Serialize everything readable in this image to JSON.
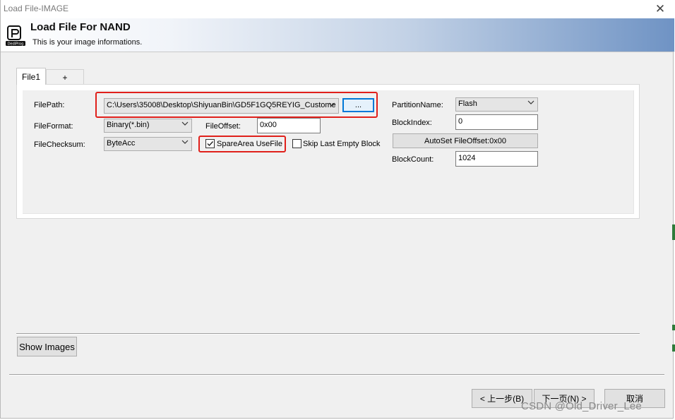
{
  "window": {
    "title": "Load File-IMAGE",
    "close_symbol": "✕"
  },
  "banner": {
    "logo_icon": "dediprog-logo-icon",
    "logo_text": "DediProg",
    "title": "Load File For NAND",
    "subtitle": "This is your image informations."
  },
  "tabs": [
    {
      "label": "File1",
      "active": true
    },
    {
      "label": "+",
      "active": false
    }
  ],
  "form": {
    "filepath_label": "FilePath:",
    "filepath_value": "C:\\Users\\35008\\Desktop\\ShiyuanBin\\GD5F1GQ5REYIG_Custome",
    "browse_label": "...",
    "fileformat_label": "FileFormat:",
    "fileformat_value": "Binary(*.bin)",
    "fileoffset_label": "FileOffset:",
    "fileoffset_value": "0x00",
    "filechecksum_label": "FileChecksum:",
    "filechecksum_value": "ByteAcc",
    "sparearea_label": "SpareArea UseFile",
    "sparearea_checked": true,
    "skip_label": "Skip Last Empty Block",
    "skip_checked": false,
    "partition_label": "PartitionName:",
    "partition_value": "Flash",
    "blockindex_label": "BlockIndex:",
    "blockindex_value": "0",
    "autoset_label": "AutoSet FileOffset:0x00",
    "blockcount_label": "BlockCount:",
    "blockcount_value": "1024"
  },
  "footer": {
    "show_images_label": "Show Images",
    "back_label": "< 上一步(B)",
    "next_label": "下一页(N) >",
    "cancel_label": "取消"
  },
  "watermark": "CSDN @Old_Driver_Lee",
  "colors": {
    "highlight_red": "#e0201b",
    "focus_blue": "#0078d7",
    "banner_gradient_end": "#6f93c4"
  }
}
